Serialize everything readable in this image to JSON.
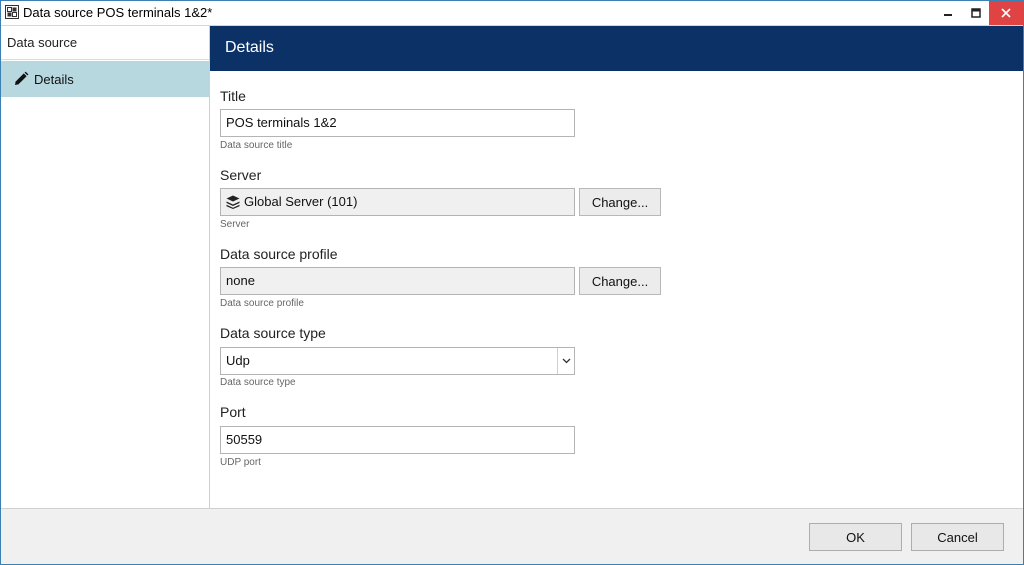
{
  "window": {
    "title": "Data source POS terminals 1&2*"
  },
  "sidebar": {
    "header": "Data source",
    "items": [
      {
        "label": "Details",
        "icon": "pencil-icon",
        "selected": true
      }
    ]
  },
  "main": {
    "header": "Details",
    "fields": {
      "title": {
        "label": "Title",
        "value": "POS terminals 1&2",
        "hint": "Data source title"
      },
      "server": {
        "label": "Server",
        "value": "Global Server (101)",
        "hint": "Server",
        "icon": "server-stack-icon",
        "button": "Change..."
      },
      "profile": {
        "label": "Data source profile",
        "value": "none",
        "hint": "Data source profile",
        "button": "Change..."
      },
      "type": {
        "label": "Data source type",
        "value": "Udp",
        "hint": "Data source type"
      },
      "port": {
        "label": "Port",
        "value": "50559",
        "hint": "UDP port"
      }
    }
  },
  "footer": {
    "ok": "OK",
    "cancel": "Cancel"
  },
  "colors": {
    "header_bg": "#0c3166",
    "selected_item_bg": "#b8d8e0",
    "close_button_bg": "#e04343"
  }
}
